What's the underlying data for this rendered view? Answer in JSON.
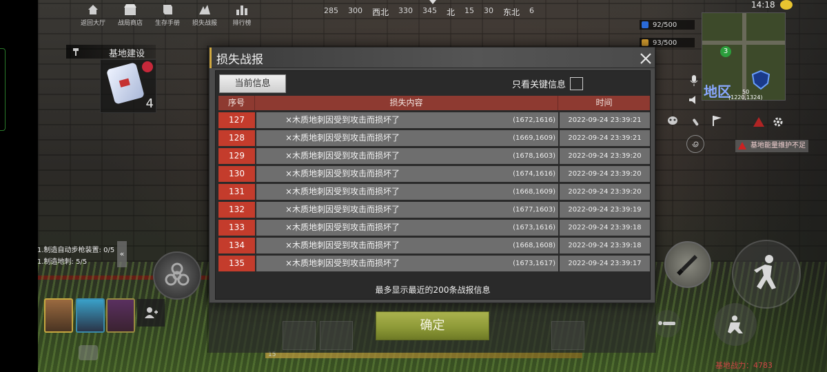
{
  "top_nav": [
    {
      "label": "返回大厅",
      "icon": "home-icon"
    },
    {
      "label": "战局商店",
      "icon": "shop-icon"
    },
    {
      "label": "生存手册",
      "icon": "book-icon"
    },
    {
      "label": "损失战报",
      "icon": "broken-icon"
    },
    {
      "label": "排行榜",
      "icon": "ranking-icon"
    }
  ],
  "compass": {
    "ticks": [
      "285",
      "300",
      "西北",
      "330",
      "345",
      "北",
      "15",
      "30",
      "东北",
      "6"
    ]
  },
  "status": {
    "time": "14:18"
  },
  "resources": [
    {
      "value": "92/500",
      "color": "#2a6ad8"
    },
    {
      "value": "93/500",
      "color": "#d8a030"
    }
  ],
  "minimap": {
    "region_label": "地区",
    "level": "50",
    "coords": "(1220,1324)",
    "badge": "3"
  },
  "left_panel": {
    "base_build_label": "基地建设",
    "item_count": "4",
    "tasks": [
      "1.制造自动步枪装置: 0/5",
      "1.制造地刺: 5/5"
    ],
    "collapse_glyph": "«"
  },
  "right_panel": {
    "warning": "基地能量维护不足",
    "base_power": "基地战力：4783"
  },
  "bottom": {
    "level_num": "15"
  },
  "modal": {
    "title": "损失战报",
    "close_glyph": "✕",
    "tab_current": "当前信息",
    "key_only_label": "只看关键信息",
    "columns": [
      "序号",
      "损失内容",
      "时间"
    ],
    "rows": [
      {
        "id": "127",
        "content": "×木质地刺因受到攻击而损坏了",
        "pos": "(1672,1616)",
        "time": "2022-09-24 23:39:21"
      },
      {
        "id": "128",
        "content": "×木质地刺因受到攻击而损坏了",
        "pos": "(1669,1609)",
        "time": "2022-09-24 23:39:21"
      },
      {
        "id": "129",
        "content": "×木质地刺因受到攻击而损坏了",
        "pos": "(1678,1603)",
        "time": "2022-09-24 23:39:20"
      },
      {
        "id": "130",
        "content": "×木质地刺因受到攻击而损坏了",
        "pos": "(1674,1616)",
        "time": "2022-09-24 23:39:20"
      },
      {
        "id": "131",
        "content": "×木质地刺因受到攻击而损坏了",
        "pos": "(1668,1609)",
        "time": "2022-09-24 23:39:20"
      },
      {
        "id": "132",
        "content": "×木质地刺因受到攻击而损坏了",
        "pos": "(1677,1603)",
        "time": "2022-09-24 23:39:19"
      },
      {
        "id": "133",
        "content": "×木质地刺因受到攻击而损坏了",
        "pos": "(1673,1616)",
        "time": "2022-09-24 23:39:18"
      },
      {
        "id": "134",
        "content": "×木质地刺因受到攻击而损坏了",
        "pos": "(1668,1608)",
        "time": "2022-09-24 23:39:18"
      },
      {
        "id": "135",
        "content": "×木质地刺因受到攻击而损坏了",
        "pos": "(1673,1617)",
        "time": "2022-09-24 23:39:17"
      }
    ],
    "footer_note": "最多显示最近的200条战报信息",
    "confirm_label": "确定"
  }
}
